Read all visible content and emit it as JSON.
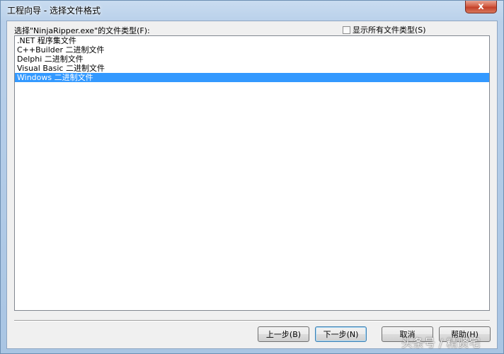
{
  "window": {
    "title": "工程向导 - 选择文件格式",
    "close_label": "x"
  },
  "prompt": {
    "label": "选择\"NinjaRipper.exe\"的文件类型(F):"
  },
  "show_all": {
    "label": "显示所有文件类型(S)",
    "checked": false
  },
  "file_types": [
    {
      "label": ".NET 程序集文件",
      "selected": false
    },
    {
      "label": "C++Builder 二进制文件",
      "selected": false
    },
    {
      "label": "Delphi 二进制文件",
      "selected": false
    },
    {
      "label": "Visual Basic 二进制文件",
      "selected": false
    },
    {
      "label": "Windows 二进制文件",
      "selected": true
    }
  ],
  "buttons": {
    "back": "上一步(B)",
    "next": "下一步(N)",
    "cancel": "取消",
    "help": "帮助(H)"
  },
  "watermark": "头条号 / 精贤宅",
  "colors": {
    "selection": "#3399ff",
    "close_button": "#c3412a"
  }
}
